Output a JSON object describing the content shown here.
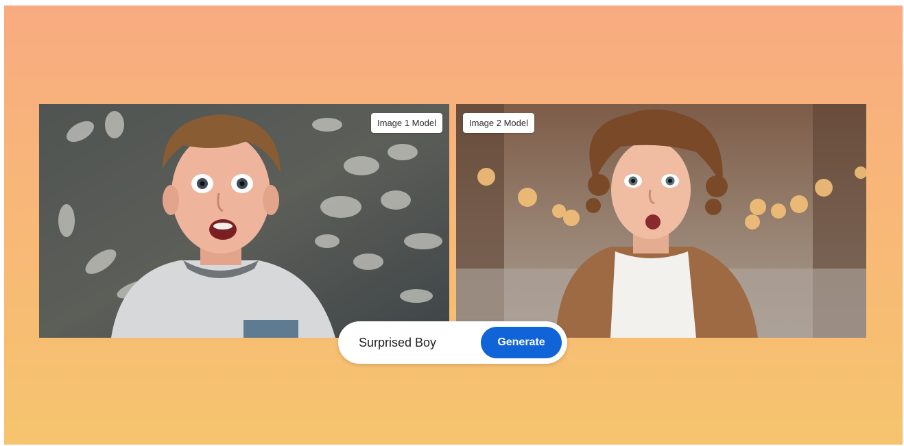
{
  "panels": [
    {
      "label": "Image 1 Model",
      "subject": "surprised-boy-white-tshirt"
    },
    {
      "label": "Image 2 Model",
      "subject": "surprised-boy-curly-hair-brown-shirt"
    }
  ],
  "prompt": {
    "value": "Surprised Boy"
  },
  "generate_button": {
    "label": "Generate"
  },
  "colors": {
    "background_top": "#f8ab80",
    "background_bottom": "#f6c46e",
    "button": "#1064d8"
  }
}
